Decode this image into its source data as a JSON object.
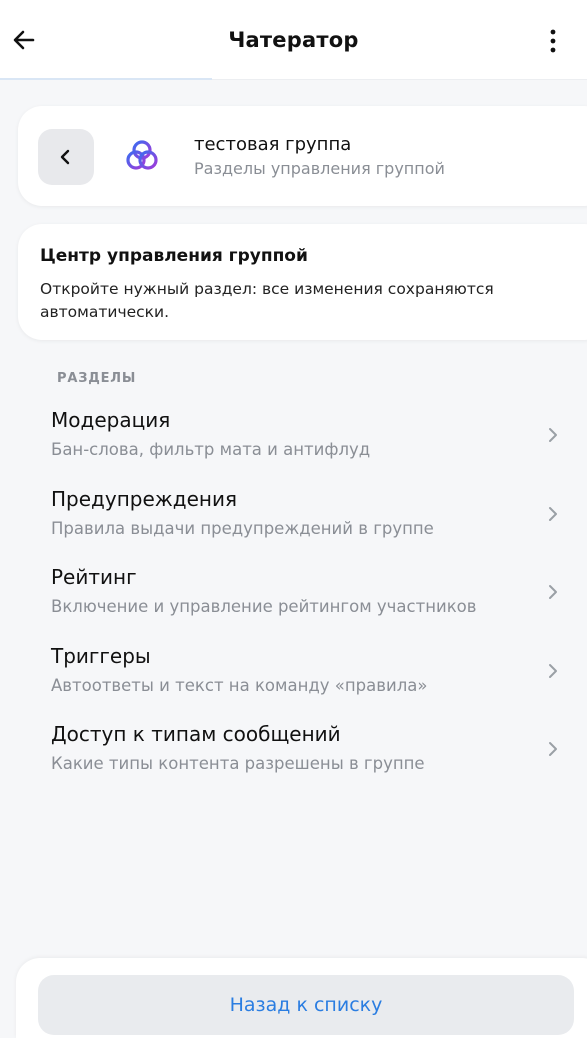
{
  "header": {
    "title": "Чатератор",
    "back_icon": "arrow-left-icon",
    "menu_icon": "more-vertical-icon"
  },
  "group_card": {
    "back_icon": "chevron-left-icon",
    "logo_icon": "interlocked-rings-logo",
    "name": "тестовая группа",
    "subtitle": "Разделы управления группой"
  },
  "info_card": {
    "title": "Центр управления группой",
    "text": "Откройте нужный раздел: все изменения сохраняются автоматически."
  },
  "sections": {
    "label": "РАЗДЕЛЫ",
    "items": [
      {
        "title": "Модерация",
        "description": "Бан-слова, фильтр мата и антифлуд"
      },
      {
        "title": "Предупреждения",
        "description": "Правила выдачи предупреждений в группе"
      },
      {
        "title": "Рейтинг",
        "description": "Включение и управление рейтингом участников"
      },
      {
        "title": "Триггеры",
        "description": "Автоответы и текст на команду «правила»"
      },
      {
        "title": "Доступ к типам сообщений",
        "description": "Какие типы контента разрешены в группе"
      }
    ]
  },
  "footer": {
    "back_to_list_label": "Назад к списку"
  },
  "colors": {
    "accent": "#2a7de1",
    "muted_text": "#8a8e95",
    "background": "#f6f7f9"
  }
}
